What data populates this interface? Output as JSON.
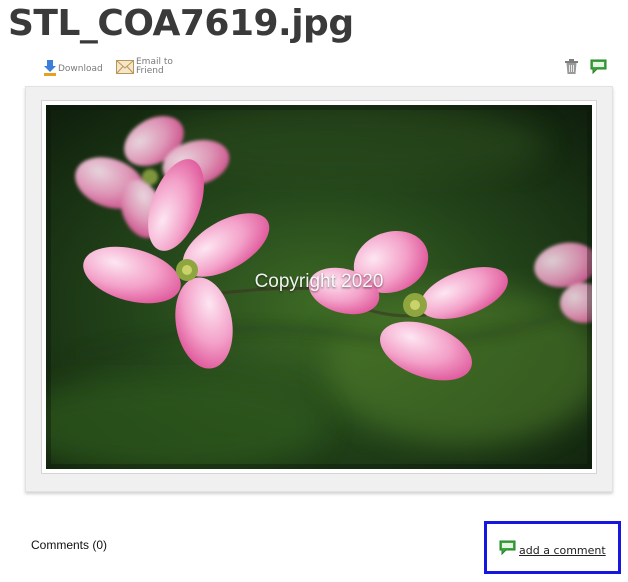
{
  "page": {
    "title": "STL_COA7619.jpg"
  },
  "toolbar": {
    "download_label": "Download",
    "email_label": "Email to Friend",
    "download_icon": "download-icon",
    "email_icon": "envelope-icon",
    "delete_icon": "trash-icon",
    "comment_icon": "comment-icon"
  },
  "photo": {
    "watermark": "Copyright 2020",
    "subject": "pink dogwood flowers"
  },
  "comments": {
    "count_label": "Comments (0)",
    "add_label": "add a comment",
    "add_icon": "comment-icon"
  },
  "colors": {
    "title": "#3a3a3a",
    "focus_outline": "#1616e0",
    "comment_icon": "#3aa83a"
  }
}
